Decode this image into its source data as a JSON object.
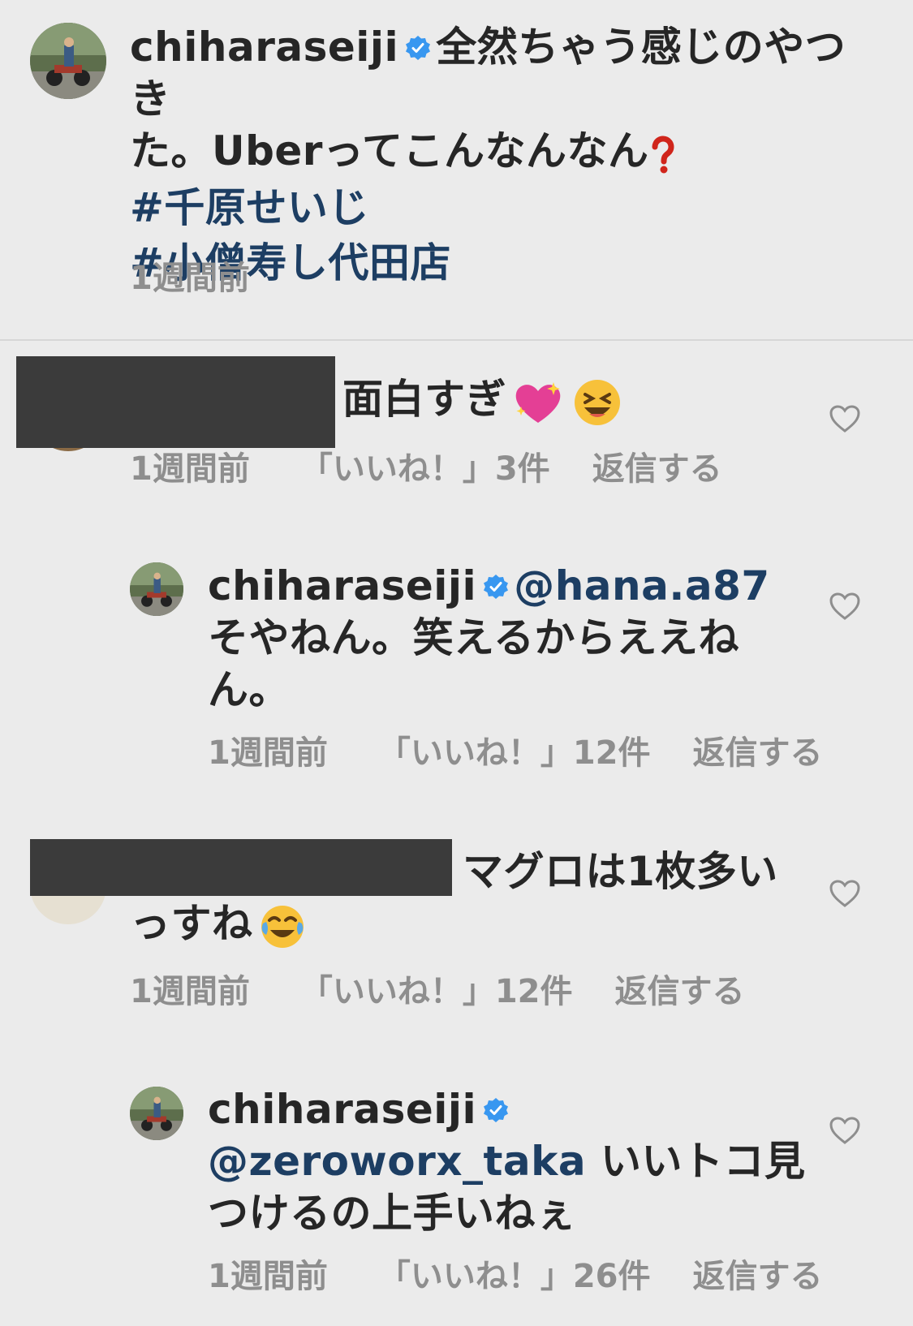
{
  "post": {
    "username": "chiharaseiji",
    "caption_line1": "全然ちゃう感じのやつき",
    "caption_line2_text": "た。Uberってこんなんなん",
    "hashtags": [
      "#千原せいじ",
      "#小僧寿し代田店"
    ],
    "time": "1週間前"
  },
  "comments": [
    {
      "text": "面白すぎ",
      "time": "1週間前",
      "likes": "「いいね！」3件",
      "reply": "返信する"
    },
    {
      "username": "chiharaseiji",
      "mention": "@hana.a87",
      "line2": "そやねん。笑えるからええね",
      "line3": "ん。",
      "time": "1週間前",
      "likes": "「いいね！」12件",
      "reply": "返信する"
    },
    {
      "text1": "マグロは1枚多い",
      "text2": "っすね",
      "time": "1週間前",
      "likes": "「いいね！」12件",
      "reply": "返信する"
    },
    {
      "username": "chiharaseiji",
      "mention": "@zeroworx_taka",
      "line2_rest": "いいトコ見",
      "line3": "つけるの上手いねぇ",
      "time": "1週間前",
      "likes": "「いいね！」26件",
      "reply": "返信する"
    }
  ],
  "icons": [
    "verified-badge-icon",
    "heart-icon",
    "sparkling-heart-emoji",
    "laughing-face-emoji",
    "tears-of-joy-emoji",
    "red-question-mark-emoji"
  ],
  "colors": {
    "background": "#ebebeb",
    "text": "#262626",
    "meta": "#8e8e8e",
    "link": "#1d3e63",
    "verified": "#3897f0"
  }
}
